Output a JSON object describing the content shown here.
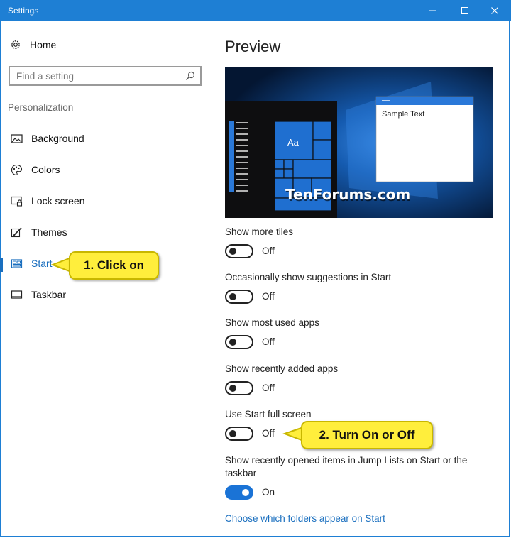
{
  "window": {
    "title": "Settings",
    "controls": {
      "minimize": "–",
      "maximize": "☐",
      "close": "✕"
    }
  },
  "sidebar": {
    "home_label": "Home",
    "search_placeholder": "Find a setting",
    "section_label": "Personalization",
    "items": [
      {
        "label": "Background",
        "icon": "picture-icon"
      },
      {
        "label": "Colors",
        "icon": "palette-icon"
      },
      {
        "label": "Lock screen",
        "icon": "lock-screen-icon"
      },
      {
        "label": "Themes",
        "icon": "brush-icon"
      },
      {
        "label": "Start",
        "icon": "start-tiles-icon",
        "selected": true
      },
      {
        "label": "Taskbar",
        "icon": "taskbar-icon"
      }
    ]
  },
  "annotations": {
    "step1": "1. Click on",
    "step2": "2. Turn On or Off"
  },
  "main": {
    "title": "Preview",
    "preview": {
      "sample_text": "Sample Text",
      "tile_text": "Aa",
      "watermark": "TenForums.com"
    },
    "settings": [
      {
        "label": "Show more tiles",
        "state": "Off"
      },
      {
        "label": "Occasionally show suggestions in Start",
        "state": "Off"
      },
      {
        "label": "Show most used apps",
        "state": "Off"
      },
      {
        "label": "Show recently added apps",
        "state": "Off"
      },
      {
        "label": "Use Start full screen",
        "state": "Off"
      },
      {
        "label": "Show recently opened items in Jump Lists on Start or the taskbar",
        "state": "On"
      }
    ],
    "folders_link": "Choose which folders appear on Start"
  },
  "colors": {
    "title_bar": "#1e7fd4",
    "accent": "#1a6fbf",
    "callout": "#ffee3c",
    "toggle_on": "#1a73d6"
  }
}
